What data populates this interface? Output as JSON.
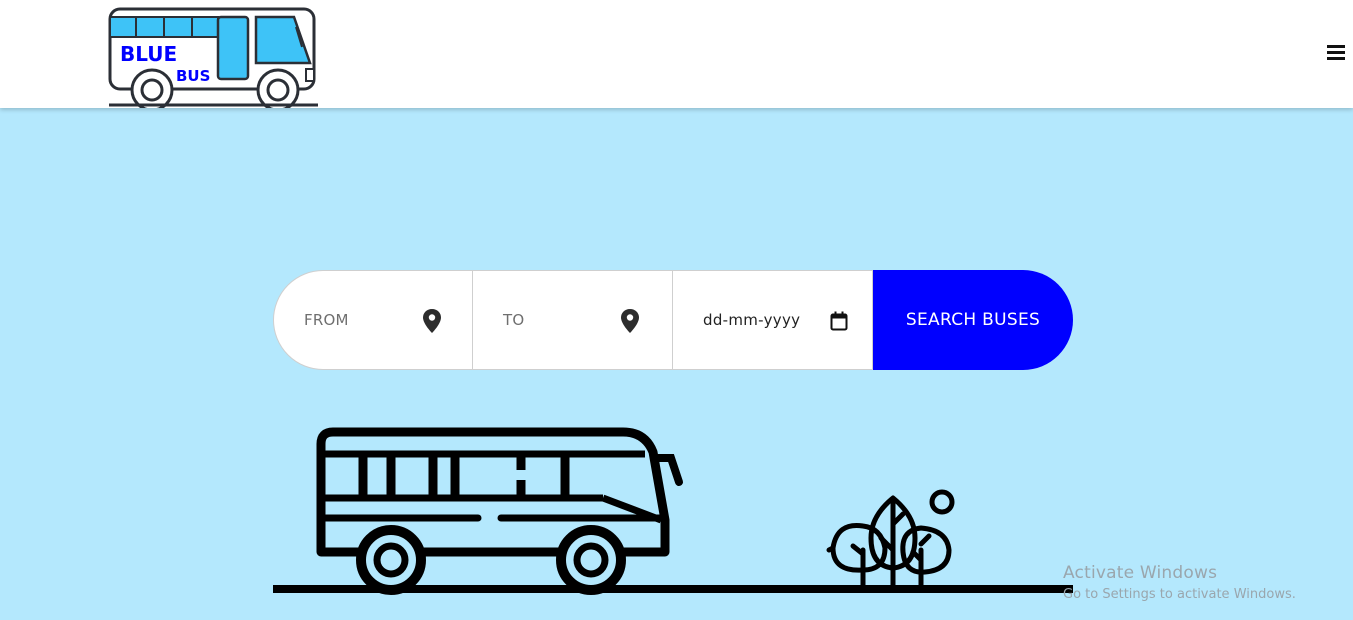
{
  "brand": {
    "line1": "BLUE",
    "line2": "BUS",
    "bus_color": "#3ec3f7",
    "text_color": "#0000ff"
  },
  "navbar": {
    "menu_icon": "hamburger-menu-icon"
  },
  "search": {
    "from_placeholder": "FROM",
    "to_placeholder": "TO",
    "date_placeholder": "dd-mm-yyyy",
    "button_label": "SEARCH BUSES",
    "pin_icon": "location-pin-icon",
    "calendar_icon": "calendar-icon",
    "button_color": "#0000ff"
  },
  "illustration": {
    "bus_icon": "bus-illustration",
    "tree_icon": "trees-illustration"
  },
  "watermark": {
    "title": "Activate Windows",
    "subtitle": "Go to Settings to activate Windows."
  },
  "colors": {
    "background": "#b4e8fd"
  }
}
